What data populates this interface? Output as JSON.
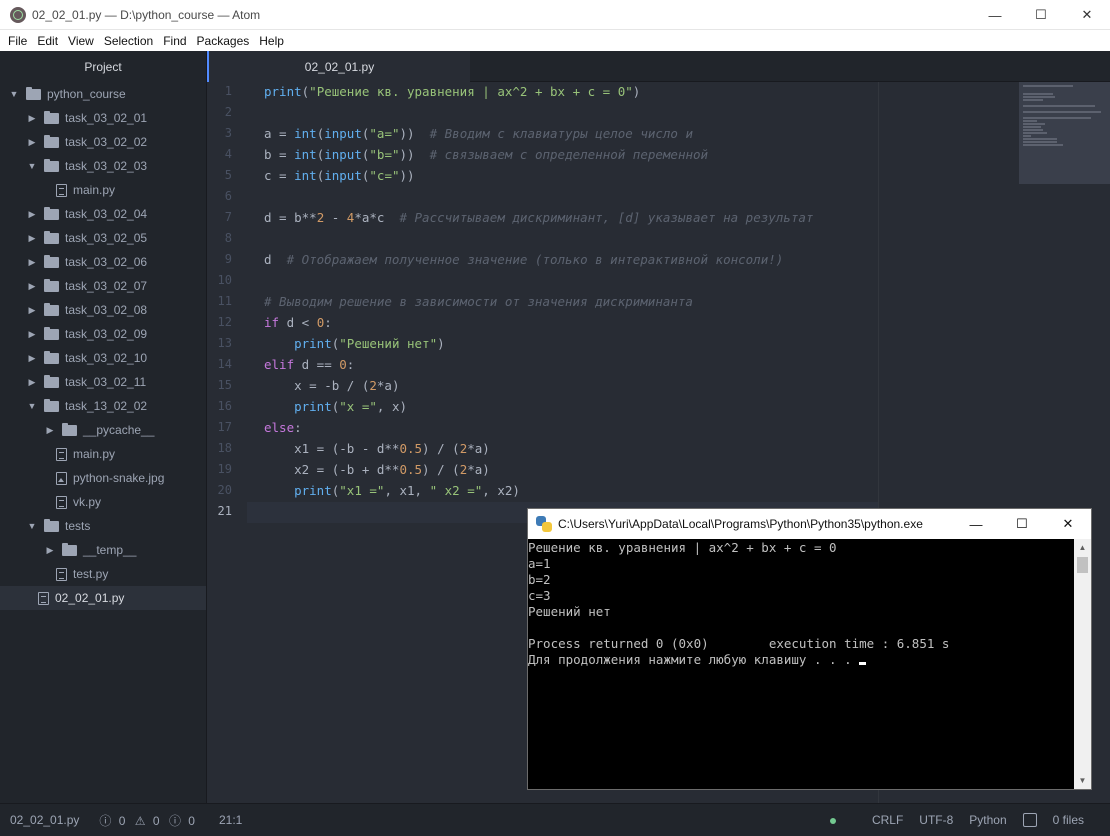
{
  "window": {
    "title": "02_02_01.py — D:\\python_course — Atom",
    "minimize": "—",
    "maximize": "☐",
    "close": "✕"
  },
  "menu": [
    "File",
    "Edit",
    "View",
    "Selection",
    "Find",
    "Packages",
    "Help"
  ],
  "sidebar": {
    "header": "Project",
    "tree": [
      {
        "label": "python_course",
        "type": "folder",
        "expanded": true,
        "depth": 0
      },
      {
        "label": "task_03_02_01",
        "type": "folder",
        "expanded": false,
        "depth": 1
      },
      {
        "label": "task_03_02_02",
        "type": "folder",
        "expanded": false,
        "depth": 1
      },
      {
        "label": "task_03_02_03",
        "type": "folder",
        "expanded": true,
        "depth": 1
      },
      {
        "label": "main.py",
        "type": "file",
        "depth": 2
      },
      {
        "label": "task_03_02_04",
        "type": "folder",
        "expanded": false,
        "depth": 1
      },
      {
        "label": "task_03_02_05",
        "type": "folder",
        "expanded": false,
        "depth": 1
      },
      {
        "label": "task_03_02_06",
        "type": "folder",
        "expanded": false,
        "depth": 1
      },
      {
        "label": "task_03_02_07",
        "type": "folder",
        "expanded": false,
        "depth": 1
      },
      {
        "label": "task_03_02_08",
        "type": "folder",
        "expanded": false,
        "depth": 1
      },
      {
        "label": "task_03_02_09",
        "type": "folder",
        "expanded": false,
        "depth": 1
      },
      {
        "label": "task_03_02_10",
        "type": "folder",
        "expanded": false,
        "depth": 1
      },
      {
        "label": "task_03_02_11",
        "type": "folder",
        "expanded": false,
        "depth": 1
      },
      {
        "label": "task_13_02_02",
        "type": "folder",
        "expanded": true,
        "depth": 1
      },
      {
        "label": "__pycache__",
        "type": "folder",
        "expanded": false,
        "depth": 2
      },
      {
        "label": "main.py",
        "type": "file",
        "depth": 2
      },
      {
        "label": "python-snake.jpg",
        "type": "image",
        "depth": 2
      },
      {
        "label": "vk.py",
        "type": "file",
        "depth": 2
      },
      {
        "label": "tests",
        "type": "folder",
        "expanded": true,
        "depth": 1
      },
      {
        "label": "__temp__",
        "type": "folder",
        "expanded": false,
        "depth": 2
      },
      {
        "label": "test.py",
        "type": "file",
        "depth": 2
      },
      {
        "label": "02_02_01.py",
        "type": "file",
        "depth": 1,
        "selected": true
      }
    ]
  },
  "tab": {
    "label": "02_02_01.py"
  },
  "editor": {
    "current_line": 21,
    "lines": [
      [
        [
          "f",
          "print"
        ],
        [
          "o",
          "("
        ],
        [
          "s",
          "\"Решение кв. уравнения | ax^2 + bx + c = 0\""
        ],
        [
          "o",
          ")"
        ]
      ],
      [],
      [
        [
          "o",
          "a = "
        ],
        [
          "f",
          "int"
        ],
        [
          "o",
          "("
        ],
        [
          "f",
          "input"
        ],
        [
          "o",
          "("
        ],
        [
          "s",
          "\"a=\""
        ],
        [
          "o",
          "))  "
        ],
        [
          "c",
          "# Вводим с клавиатуры целое число и"
        ]
      ],
      [
        [
          "o",
          "b = "
        ],
        [
          "f",
          "int"
        ],
        [
          "o",
          "("
        ],
        [
          "f",
          "input"
        ],
        [
          "o",
          "("
        ],
        [
          "s",
          "\"b=\""
        ],
        [
          "o",
          "))  "
        ],
        [
          "c",
          "# связываем с определенной переменной"
        ]
      ],
      [
        [
          "o",
          "c = "
        ],
        [
          "f",
          "int"
        ],
        [
          "o",
          "("
        ],
        [
          "f",
          "input"
        ],
        [
          "o",
          "("
        ],
        [
          "s",
          "\"c=\""
        ],
        [
          "o",
          "))"
        ]
      ],
      [],
      [
        [
          "o",
          "d = b**"
        ],
        [
          "n",
          "2"
        ],
        [
          "o",
          " - "
        ],
        [
          "n",
          "4"
        ],
        [
          "o",
          "*a*c  "
        ],
        [
          "c",
          "# Рассчитываем дискриминант, [d] указывает на результат"
        ]
      ],
      [],
      [
        [
          "o",
          "d  "
        ],
        [
          "c",
          "# Отображаем полученное значение (только в интерактивной консоли!)"
        ]
      ],
      [],
      [
        [
          "c",
          "# Выводим решение в зависимости от значения дискриминанта"
        ]
      ],
      [
        [
          "k",
          "if"
        ],
        [
          "o",
          " d < "
        ],
        [
          "n",
          "0"
        ],
        [
          "o",
          ":"
        ]
      ],
      [
        [
          "o",
          "    "
        ],
        [
          "f",
          "print"
        ],
        [
          "o",
          "("
        ],
        [
          "s",
          "\"Решений нет\""
        ],
        [
          "o",
          ")"
        ]
      ],
      [
        [
          "k",
          "elif"
        ],
        [
          "o",
          " d == "
        ],
        [
          "n",
          "0"
        ],
        [
          "o",
          ":"
        ]
      ],
      [
        [
          "o",
          "    x = -b / ("
        ],
        [
          "n",
          "2"
        ],
        [
          "o",
          "*a)"
        ]
      ],
      [
        [
          "o",
          "    "
        ],
        [
          "f",
          "print"
        ],
        [
          "o",
          "("
        ],
        [
          "s",
          "\"x =\""
        ],
        [
          "o",
          ", x)"
        ]
      ],
      [
        [
          "k",
          "else"
        ],
        [
          "o",
          ":"
        ]
      ],
      [
        [
          "o",
          "    x1 = (-b - d**"
        ],
        [
          "n",
          "0.5"
        ],
        [
          "o",
          ") / ("
        ],
        [
          "n",
          "2"
        ],
        [
          "o",
          "*a)"
        ]
      ],
      [
        [
          "o",
          "    x2 = (-b + d**"
        ],
        [
          "n",
          "0.5"
        ],
        [
          "o",
          ") / ("
        ],
        [
          "n",
          "2"
        ],
        [
          "o",
          "*a)"
        ]
      ],
      [
        [
          "o",
          "    "
        ],
        [
          "f",
          "print"
        ],
        [
          "o",
          "("
        ],
        [
          "s",
          "\"x1 =\""
        ],
        [
          "o",
          ", x1, "
        ],
        [
          "s",
          "\" x2 =\""
        ],
        [
          "o",
          ", x2)"
        ]
      ],
      []
    ]
  },
  "console": {
    "title": "C:\\Users\\Yuri\\AppData\\Local\\Programs\\Python\\Python35\\python.exe",
    "lines": [
      "Решение кв. уравнения | ax^2 + bx + c = 0",
      "a=1",
      "b=2",
      "c=3",
      "Решений нет",
      "",
      "Process returned 0 (0x0)        execution time : 6.851 s",
      "Для продолжения нажмите любую клавишу . . . "
    ]
  },
  "status": {
    "file": "02_02_01.py",
    "errors": "0",
    "warnings": "0",
    "infos": "0",
    "cursor": "21:1",
    "line_ending": "CRLF",
    "encoding": "UTF-8",
    "grammar": "Python",
    "files": "0 files"
  },
  "colors": {
    "keyword": "#c678dd",
    "function": "#61afef",
    "string": "#98c379",
    "comment": "#5c6370",
    "number": "#d19a66",
    "accent": "#528bff"
  }
}
